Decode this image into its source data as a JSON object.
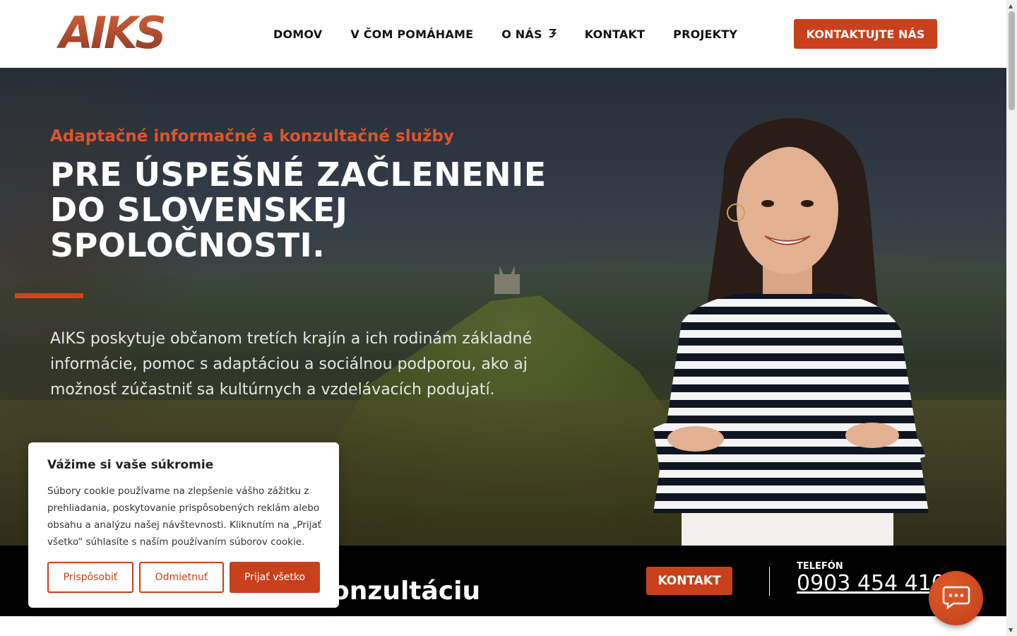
{
  "header": {
    "logo_text": "AIKS",
    "nav": [
      {
        "label": "DOMOV"
      },
      {
        "label": "V ČOM POMÁHAME"
      },
      {
        "label": "O NÁS",
        "has_dropdown": true
      },
      {
        "label": "KONTAKT"
      },
      {
        "label": "PROJEKTY"
      }
    ],
    "cta_label": "KONTAKTUJTE NÁS"
  },
  "hero": {
    "subtitle": "Adaptačné informačné a konzultačné služby",
    "title_lines": [
      "PRE ÚSPEŠNÉ ZAČLENENIE",
      "DO SLOVENSKEJ",
      "SPOLOČNOSTI."
    ],
    "description": "AIKS poskytuje občanom tretích krajín a ich rodinám základné informácie, pomoc s adaptáciou a sociálnou podporou, ako aj možnosť zúčastniť sa kultúrnych a vzdelávacích podujatí."
  },
  "bottom_bar": {
    "heading": "onzultáciu",
    "kontakt_label": "KONTAKT",
    "phone_label": "TELEFÓN",
    "phone_number": "0903 454 410"
  },
  "cookie": {
    "title": "Vážime si vaše súkromie",
    "text": "Súbory cookie používame na zlepšenie vášho zážitku z prehliadania, poskytovanie prispôsobených reklám alebo obsahu a analýzu našej návštevnosti. Kliknutím na „Prijať všetko“ súhlasíte s naším používaním súborov cookie.",
    "customize_label": "Prispôsobiť",
    "reject_label": "Odmietnuť",
    "accept_label": "Prijať všetko"
  },
  "icons": {
    "dropdown": "chevron-down-icon",
    "chat": "chat-bubble-icon"
  },
  "colors": {
    "accent": "#c8401c",
    "subtitle": "#d9562c",
    "bar": "#000000"
  }
}
